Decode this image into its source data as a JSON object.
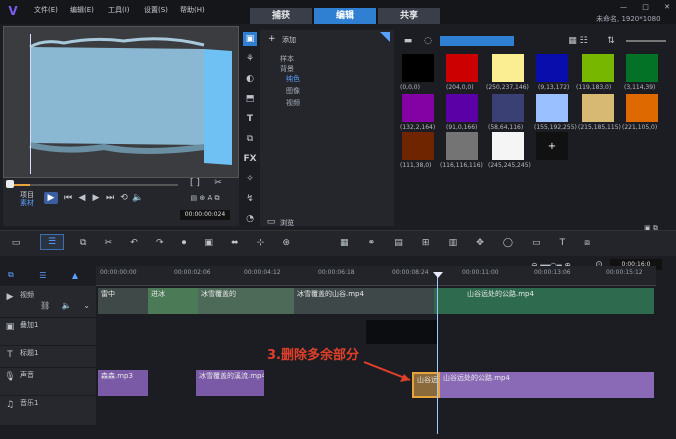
{
  "menu": {
    "file": "文件(E)",
    "edit": "编辑(E)",
    "tools": "工具(I)",
    "settings": "设置(S)",
    "help": "帮助(H)"
  },
  "tabs": {
    "capture": "捕获",
    "edit": "编辑",
    "share": "共享"
  },
  "project": {
    "name": "未命名, 1920*1080"
  },
  "player": {
    "project_label": "项目",
    "clip_label": "素材",
    "timecode": "00:00:00:024"
  },
  "library": {
    "add_label": "添加",
    "categories": [
      "样本",
      "背景",
      "纯色",
      "图像",
      "视频"
    ],
    "browse_label": "浏览"
  },
  "swatches": [
    {
      "label": "(0,0,0)",
      "color": "#000000"
    },
    {
      "label": "(204,0,0)",
      "color": "#cc0000"
    },
    {
      "label": "(250,237,146)",
      "color": "#faed92"
    },
    {
      "label": "(9,13,172)",
      "color": "#090dac"
    },
    {
      "label": "(119,183,0)",
      "color": "#77b700"
    },
    {
      "label": "(3,114,39)",
      "color": "#037227"
    },
    {
      "label": "(132,2,164)",
      "color": "#8402a4"
    },
    {
      "label": "(91,0,166)",
      "color": "#5b00a6"
    },
    {
      "label": "(58,64,116)",
      "color": "#3a4074"
    },
    {
      "label": "(155,192,255)",
      "color": "#9bc0ff"
    },
    {
      "label": "(215,185,115)",
      "color": "#d7b973"
    },
    {
      "label": "(221,105,0)",
      "color": "#dd6900"
    },
    {
      "label": "(111,38,0)",
      "color": "#6f2600"
    },
    {
      "label": "(116,116,116)",
      "color": "#747474"
    },
    {
      "label": "(245,245,245)",
      "color": "#f5f5f5"
    },
    {
      "label": "",
      "color": "#111111"
    }
  ],
  "timeline": {
    "ruler": [
      "00:00:00:00",
      "00:00:02:06",
      "00:00:04:12",
      "00:00:06:18",
      "00:00:08:24",
      "00:00:11:00",
      "00:00:13:06",
      "00:00:15:12"
    ],
    "zoom_readout": "0:00:16:0",
    "tracks": {
      "video": "视频",
      "overlay": "叠加1",
      "title": "标题1",
      "voice": "声音",
      "music": "音乐1"
    },
    "clips": {
      "v1": "雷中",
      "v2": "进冰",
      "v3": "冰雪覆盖的",
      "v4": "冰雪覆盖的山谷.mp4",
      "v5": "山谷远处的公路.mp4",
      "a1": "森森.mp3",
      "a2": "冰雪覆盖的溪流.mp4",
      "a3": "山谷远",
      "a4": "山谷远处的公路.mp4"
    },
    "annotation": "3.删除多余部分"
  }
}
